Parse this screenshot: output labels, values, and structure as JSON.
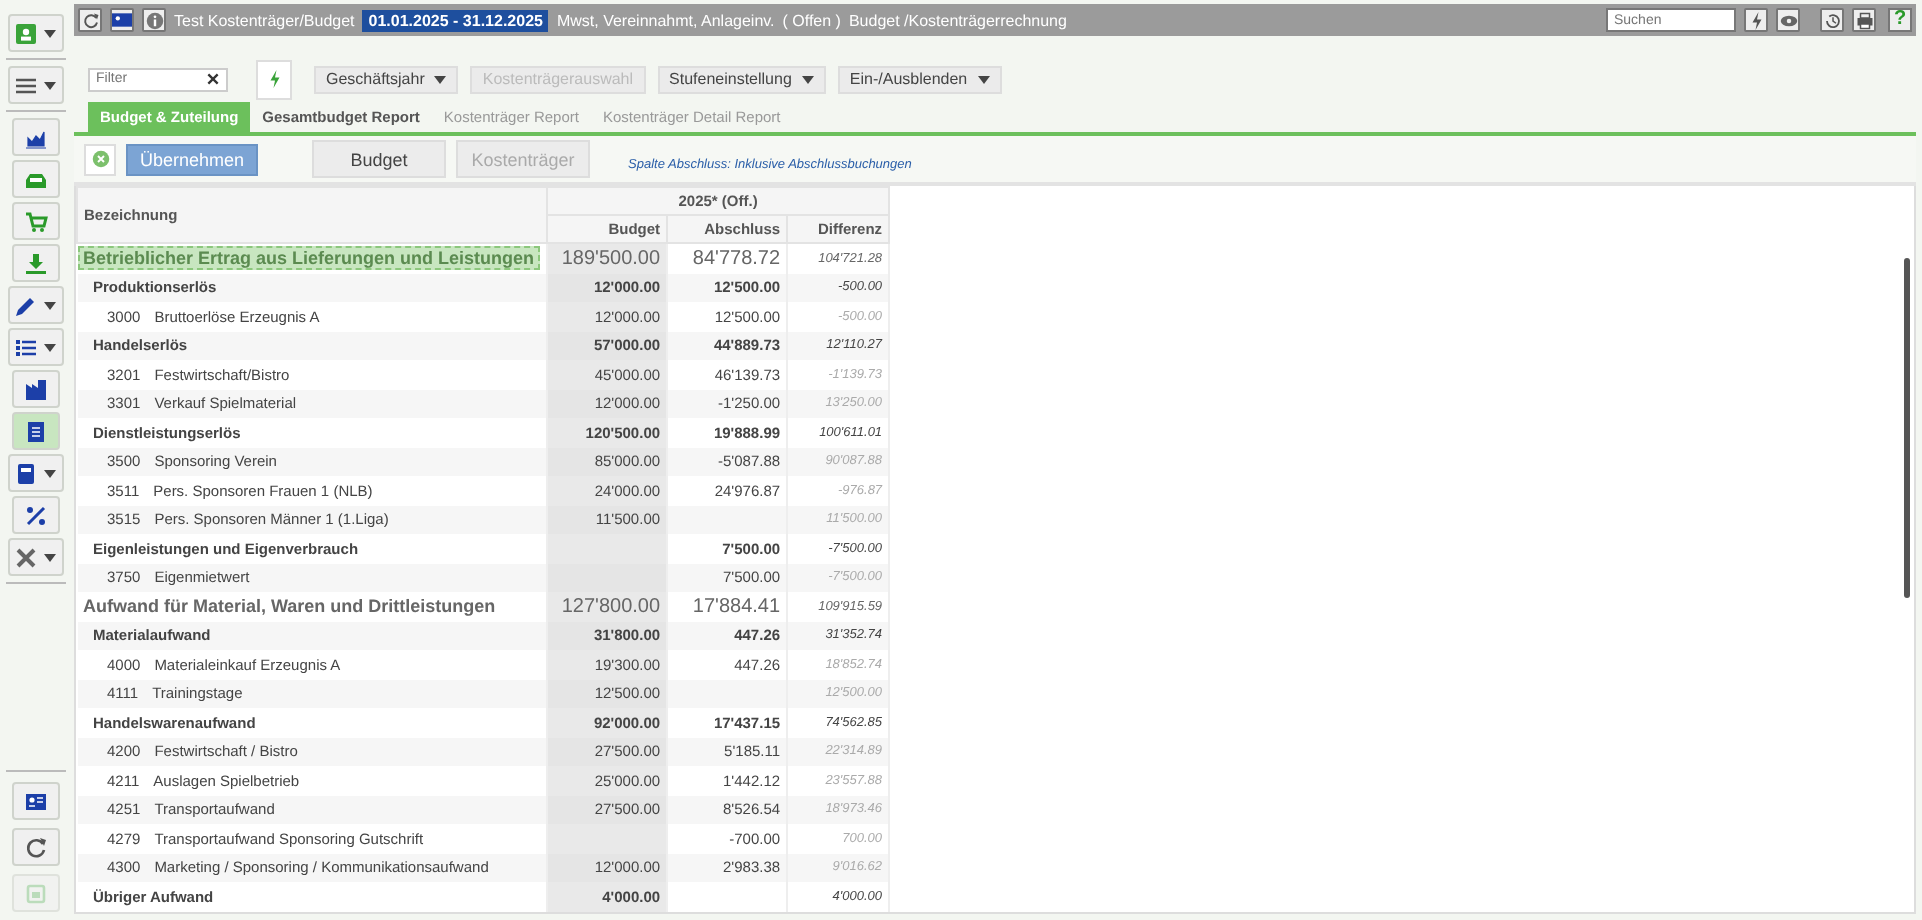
{
  "sidebar": {
    "groups": [
      [
        {
          "selected": false,
          "menu": true
        }
      ],
      [
        {
          "selected": false,
          "menu": true
        }
      ],
      [
        {
          "selected": false,
          "menu": false
        },
        {
          "selected": false,
          "menu": false
        },
        {
          "selected": false,
          "menu": false
        },
        {
          "selected": false,
          "menu": false
        },
        {
          "selected": false,
          "menu": true
        },
        {
          "selected": false,
          "menu": true
        },
        {
          "selected": false,
          "menu": false
        },
        {
          "selected": true,
          "menu": false
        },
        {
          "selected": false,
          "menu": true
        },
        {
          "selected": false,
          "menu": false
        },
        {
          "selected": false,
          "menu": true
        }
      ]
    ],
    "bottom": [
      {
        "selected": false,
        "menu": false,
        "disabled": false
      },
      {
        "selected": false,
        "menu": false,
        "disabled": false
      },
      {
        "selected": false,
        "menu": false,
        "disabled": true
      }
    ]
  },
  "header": {
    "title": "Test Kostenträger/Budget",
    "period": "01.01.2025 - 31.12.2025",
    "options": "Mwst, Vereinnahmt, Anlageinv.",
    "status": "( Offen )",
    "module": "Budget /Kostenträgerrechnung",
    "search": {
      "placeholder": "Suchen"
    },
    "help": "?"
  },
  "toolbar": {
    "filter": {
      "placeholder": "Filter"
    },
    "dropdowns": [
      {
        "label": "Geschäftsjahr",
        "disabled": false,
        "menu": true
      },
      {
        "label": "Kostenträgerauswahl",
        "disabled": true,
        "menu": false
      },
      {
        "label": "Stufeneinstellung",
        "disabled": false,
        "menu": true
      },
      {
        "label": "Ein-/Ausblenden",
        "disabled": false,
        "menu": true
      }
    ]
  },
  "tabs": [
    {
      "label": "Budget & Zuteilung",
      "selected": true,
      "disabled": false
    },
    {
      "label": "Gesamtbudget Report",
      "selected": false,
      "disabled": false
    },
    {
      "label": "Kostenträger Report",
      "selected": false,
      "disabled": true
    },
    {
      "label": "Kostenträger Detail Report",
      "selected": false,
      "disabled": true
    }
  ],
  "actions": {
    "apply": "Übernehmen",
    "buttons": [
      {
        "label": "Budget",
        "disabled": false
      },
      {
        "label": "Kostenträger",
        "disabled": true
      }
    ],
    "note": "Spalte Abschluss: Inklusive Abschlussbuchungen"
  },
  "table": {
    "columns": [
      {
        "label": "Bezeichnung"
      },
      {
        "label": "Budget"
      },
      {
        "label": "Abschluss"
      },
      {
        "label": "Differenz"
      }
    ],
    "group_header": "2025* (Off.)",
    "rows": [
      {
        "kind": "group",
        "selected": true,
        "name": "Betrieblicher Ertrag aus Lieferungen und Leistungen",
        "budget": "189'500.00",
        "actual": "84'778.72",
        "diff": "104'721.28"
      },
      {
        "kind": "subtotal",
        "selected": false,
        "name": "Produktionserlös",
        "budget": "12'000.00",
        "actual": "12'500.00",
        "diff": "-500.00"
      },
      {
        "kind": "account",
        "selected": false,
        "number": "3000",
        "name": "Bruttoerlöse Erzeugnis A",
        "budget": "12'000.00",
        "actual": "12'500.00",
        "diff": "-500.00"
      },
      {
        "kind": "subtotal",
        "selected": false,
        "name": "Handelserlös",
        "budget": "57'000.00",
        "actual": "44'889.73",
        "diff": "12'110.27"
      },
      {
        "kind": "account",
        "selected": false,
        "number": "3201",
        "name": "Festwirtschaft/Bistro",
        "budget": "45'000.00",
        "actual": "46'139.73",
        "diff": "-1'139.73"
      },
      {
        "kind": "account",
        "selected": false,
        "number": "3301",
        "name": "Verkauf Spielmaterial",
        "budget": "12'000.00",
        "actual": "-1'250.00",
        "diff": "13'250.00"
      },
      {
        "kind": "subtotal",
        "selected": false,
        "name": "Dienstleistungserlös",
        "budget": "120'500.00",
        "actual": "19'888.99",
        "diff": "100'611.01"
      },
      {
        "kind": "account",
        "selected": false,
        "number": "3500",
        "name": "Sponsoring Verein",
        "budget": "85'000.00",
        "actual": "-5'087.88",
        "diff": "90'087.88"
      },
      {
        "kind": "account",
        "selected": false,
        "number": "3511",
        "name": "Pers. Sponsoren Frauen 1 (NLB)",
        "budget": "24'000.00",
        "actual": "24'976.87",
        "diff": "-976.87"
      },
      {
        "kind": "account",
        "selected": false,
        "number": "3515",
        "name": "Pers. Sponsoren Männer 1 (1.Liga)",
        "budget": "11'500.00",
        "diff": "11'500.00"
      },
      {
        "kind": "subtotal",
        "selected": false,
        "name": "Eigenleistungen und Eigenverbrauch",
        "actual": "7'500.00",
        "diff": "-7'500.00"
      },
      {
        "kind": "account",
        "selected": false,
        "number": "3750",
        "name": "Eigenmietwert",
        "actual": "7'500.00",
        "diff": "-7'500.00"
      },
      {
        "kind": "group",
        "selected": false,
        "name": "Aufwand für Material, Waren und Drittleistungen",
        "budget": "127'800.00",
        "actual": "17'884.41",
        "diff": "109'915.59"
      },
      {
        "kind": "subtotal",
        "selected": false,
        "name": "Materialaufwand",
        "budget": "31'800.00",
        "actual": "447.26",
        "diff": "31'352.74"
      },
      {
        "kind": "account",
        "selected": false,
        "number": "4000",
        "name": "Materialeinkauf Erzeugnis A",
        "budget": "19'300.00",
        "actual": "447.26",
        "diff": "18'852.74"
      },
      {
        "kind": "account",
        "selected": false,
        "number": "4111",
        "name": "Trainingstage",
        "budget": "12'500.00",
        "diff": "12'500.00"
      },
      {
        "kind": "subtotal",
        "selected": false,
        "name": "Handelswarenaufwand",
        "budget": "92'000.00",
        "actual": "17'437.15",
        "diff": "74'562.85"
      },
      {
        "kind": "account",
        "selected": false,
        "number": "4200",
        "name": "Festwirtschaft / Bistro",
        "budget": "27'500.00",
        "actual": "5'185.11",
        "diff": "22'314.89"
      },
      {
        "kind": "account",
        "selected": false,
        "number": "4211",
        "name": "Auslagen Spielbetrieb",
        "budget": "25'000.00",
        "actual": "1'442.12",
        "diff": "23'557.88"
      },
      {
        "kind": "account",
        "selected": false,
        "number": "4251",
        "name": "Transportaufwand",
        "budget": "27'500.00",
        "actual": "8'526.54",
        "diff": "18'973.46"
      },
      {
        "kind": "account",
        "selected": false,
        "number": "4279",
        "name": "Transportaufwand Sponsoring Gutschrift",
        "actual": "-700.00",
        "diff": "700.00"
      },
      {
        "kind": "account",
        "selected": false,
        "number": "4300",
        "name": "Marketing / Sponsoring / Kommunikationsaufwand",
        "budget": "12'000.00",
        "actual": "2'983.38",
        "diff": "9'016.62"
      },
      {
        "kind": "subtotal",
        "selected": false,
        "name": "Übriger Aufwand",
        "budget": "4'000.00",
        "diff": "4'000.00"
      }
    ]
  }
}
